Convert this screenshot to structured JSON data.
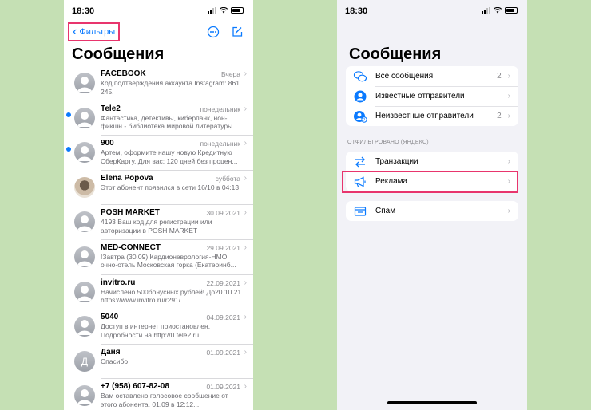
{
  "left": {
    "status": {
      "time": "18:30"
    },
    "nav": {
      "back_label": "Фильтры",
      "more_icon": "ellipsis-circle-icon",
      "compose_icon": "compose-icon"
    },
    "title": "Сообщения",
    "messages": [
      {
        "name": "FACEBOOK",
        "date": "Вчера",
        "preview": "Код подтверждения аккаунта Instagram: 861 245.",
        "unread": false,
        "avatar": "person"
      },
      {
        "name": "Tele2",
        "date": "понедельник",
        "preview": "Фантастика, детективы, киберпанк, нон-фикшн - библиотека мировой литературы...",
        "unread": true,
        "avatar": "person"
      },
      {
        "name": "900",
        "date": "понедельник",
        "preview": "Артем, оформите нашу новую Кредитную СберКарту. Для вас: 120 дней без процен...",
        "unread": true,
        "avatar": "person"
      },
      {
        "name": "Elena Popova",
        "date": "суббота",
        "preview": "Этот абонент появился в сети 16/10 в 04:13",
        "unread": false,
        "avatar": "photo"
      },
      {
        "name": "POSH MARKET",
        "date": "30.09.2021",
        "preview": "4193 Ваш код для регистрации или авторизации в POSH MARKET",
        "unread": false,
        "avatar": "person"
      },
      {
        "name": "MED-CONNECT",
        "date": "29.09.2021",
        "preview": "!Завтра (30.09) Кардионеврология-НМО, очно-отель Московская горка (Екатеринб...",
        "unread": false,
        "avatar": "person"
      },
      {
        "name": "invitro.ru",
        "date": "22.09.2021",
        "preview": "Начислено 500бонусных рублей! До20.10.21 https://www.invitro.ru/r291/",
        "unread": false,
        "avatar": "person"
      },
      {
        "name": "5040",
        "date": "04.09.2021",
        "preview": "Доступ в интернет приостановлен. Подробности на http://0.tele2.ru",
        "unread": false,
        "avatar": "person"
      },
      {
        "name": "Даня",
        "date": "01.09.2021",
        "preview": "Спасибо",
        "unread": false,
        "avatar": "letter",
        "letter": "Д"
      },
      {
        "name": "+7 (958) 607-82-08",
        "date": "01.09.2021",
        "preview": "Вам оставлено голосовое сообщение от этого абонента. 01.09 в 12:12...",
        "unread": false,
        "avatar": "person"
      }
    ]
  },
  "right": {
    "status": {
      "time": "18:30"
    },
    "title": "Сообщения",
    "group1": [
      {
        "label": "Все сообщения",
        "count": "2",
        "icon": "bubbles-icon"
      },
      {
        "label": "Известные отправители",
        "count": "",
        "icon": "person-circle-icon"
      },
      {
        "label": "Неизвестные отправители",
        "count": "2",
        "icon": "person-question-icon"
      }
    ],
    "section_header": "ОТФИЛЬТРОВАНО (ЯНДЕКС)",
    "group2": [
      {
        "label": "Транзакции",
        "icon": "arrows-swap-icon"
      },
      {
        "label": "Реклама",
        "icon": "megaphone-icon"
      }
    ],
    "group3": [
      {
        "label": "Спам",
        "icon": "spam-box-icon"
      }
    ]
  },
  "colors": {
    "accent": "#0a7aff",
    "highlight": "#e8356d",
    "background": "#c5e0b4"
  }
}
